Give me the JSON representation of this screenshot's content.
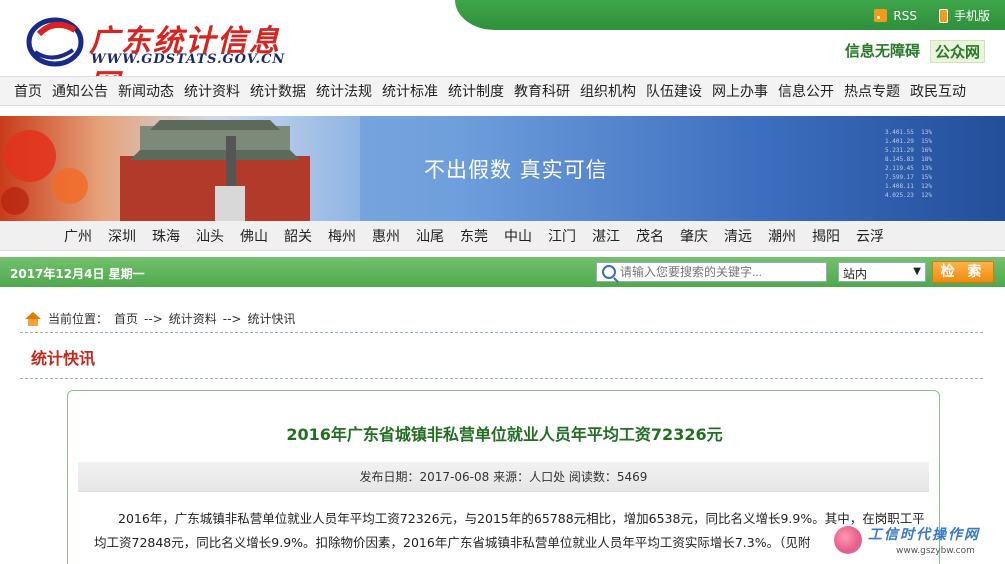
{
  "header": {
    "logo_cn": "广东统计信息网",
    "logo_en": "WWW.GDSTATS.GOV.CN",
    "rss_label": "RSS",
    "mobile_label": "手机版",
    "accessible_label": "信息无障碍",
    "public_label": "公众网"
  },
  "main_nav": [
    "首页",
    "通知公告",
    "新闻动态",
    "统计资料",
    "统计数据",
    "统计法规",
    "统计标准",
    "统计制度",
    "教育科研",
    "组织机构",
    "队伍建设",
    "网上办事",
    "信息公开",
    "热点专题",
    "政民互动"
  ],
  "banner": {
    "slogan": "不出假数 真实可信"
  },
  "city_nav": [
    "广州",
    "深圳",
    "珠海",
    "汕头",
    "佛山",
    "韶关",
    "梅州",
    "惠州",
    "汕尾",
    "东莞",
    "中山",
    "江门",
    "湛江",
    "茂名",
    "肇庆",
    "清远",
    "潮州",
    "揭阳",
    "云浮"
  ],
  "search": {
    "date": "2017年12月4日 星期一",
    "placeholder": "请输入您要搜索的关键字...",
    "scope": "站内",
    "button": "检 索"
  },
  "breadcrumb": {
    "prefix": "当前位置：",
    "items": [
      "首页",
      "-->",
      "统计资料",
      "-->",
      "统计快讯"
    ]
  },
  "section_title": "统计快讯",
  "article": {
    "title": "2016年广东省城镇非私营单位就业人员年平均工资72326元",
    "meta": "发布日期：2017-06-08    来源：人口处    阅读数：5469",
    "body": "2016年，广东城镇非私营单位就业人员年平均工资72326元，与2015年的65788元相比，增加6538元，同比名义增长9.9%。其中，在岗职工平均工资72848元，同比名义增长9.9%。扣除物价因素，2016年广东省城镇非私营单位就业人员年平均工资实际增长7.3%。（见附"
  },
  "watermark": {
    "title": "工信时代操作网",
    "url": "www.gszybw.com"
  }
}
